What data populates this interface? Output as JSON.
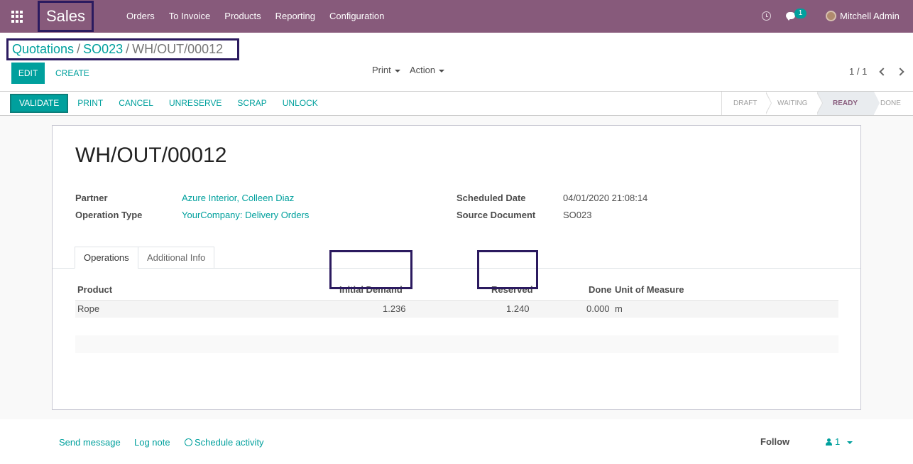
{
  "navbar": {
    "app_name": "Sales",
    "menu": [
      "Orders",
      "To Invoice",
      "Products",
      "Reporting",
      "Configuration"
    ],
    "messages_count": "1",
    "user_name": "Mitchell Admin"
  },
  "breadcrumb": {
    "items": [
      "Quotations",
      "SO023"
    ],
    "separator": "/",
    "current": "WH/OUT/00012"
  },
  "controls": {
    "edit_label": "EDIT",
    "create_label": "CREATE",
    "print_label": "Print",
    "action_label": "Action",
    "pager": "1 / 1"
  },
  "statusbar": {
    "buttons": [
      "VALIDATE",
      "PRINT",
      "CANCEL",
      "UNRESERVE",
      "SCRAP",
      "UNLOCK"
    ],
    "stages": [
      "DRAFT",
      "WAITING",
      "READY",
      "DONE"
    ],
    "active_stage": "READY"
  },
  "record": {
    "title": "WH/OUT/00012",
    "partner_label": "Partner",
    "partner_value": "Azure Interior, Colleen Diaz",
    "operation_type_label": "Operation Type",
    "operation_type_value": "YourCompany: Delivery Orders",
    "scheduled_date_label": "Scheduled Date",
    "scheduled_date_value": "04/01/2020 21:08:14",
    "source_document_label": "Source Document",
    "source_document_value": "SO023"
  },
  "tabs": [
    "Operations",
    "Additional Info"
  ],
  "operations": {
    "columns": [
      "Product",
      "Initial Demand",
      "Reserved",
      "Done",
      "Unit of Measure"
    ],
    "rows": [
      {
        "product": "Rope",
        "initial_demand": "1.236",
        "reserved": "1.240",
        "done": "0.000",
        "uom": "m"
      }
    ]
  },
  "chatter": {
    "send_message": "Send message",
    "log_note": "Log note",
    "schedule_activity": "Schedule activity",
    "follow": "Follow",
    "followers_count": "1"
  },
  "colors": {
    "brand": "#875a7b",
    "accent": "#00a09d",
    "highlight_border": "#2b1a5f"
  }
}
